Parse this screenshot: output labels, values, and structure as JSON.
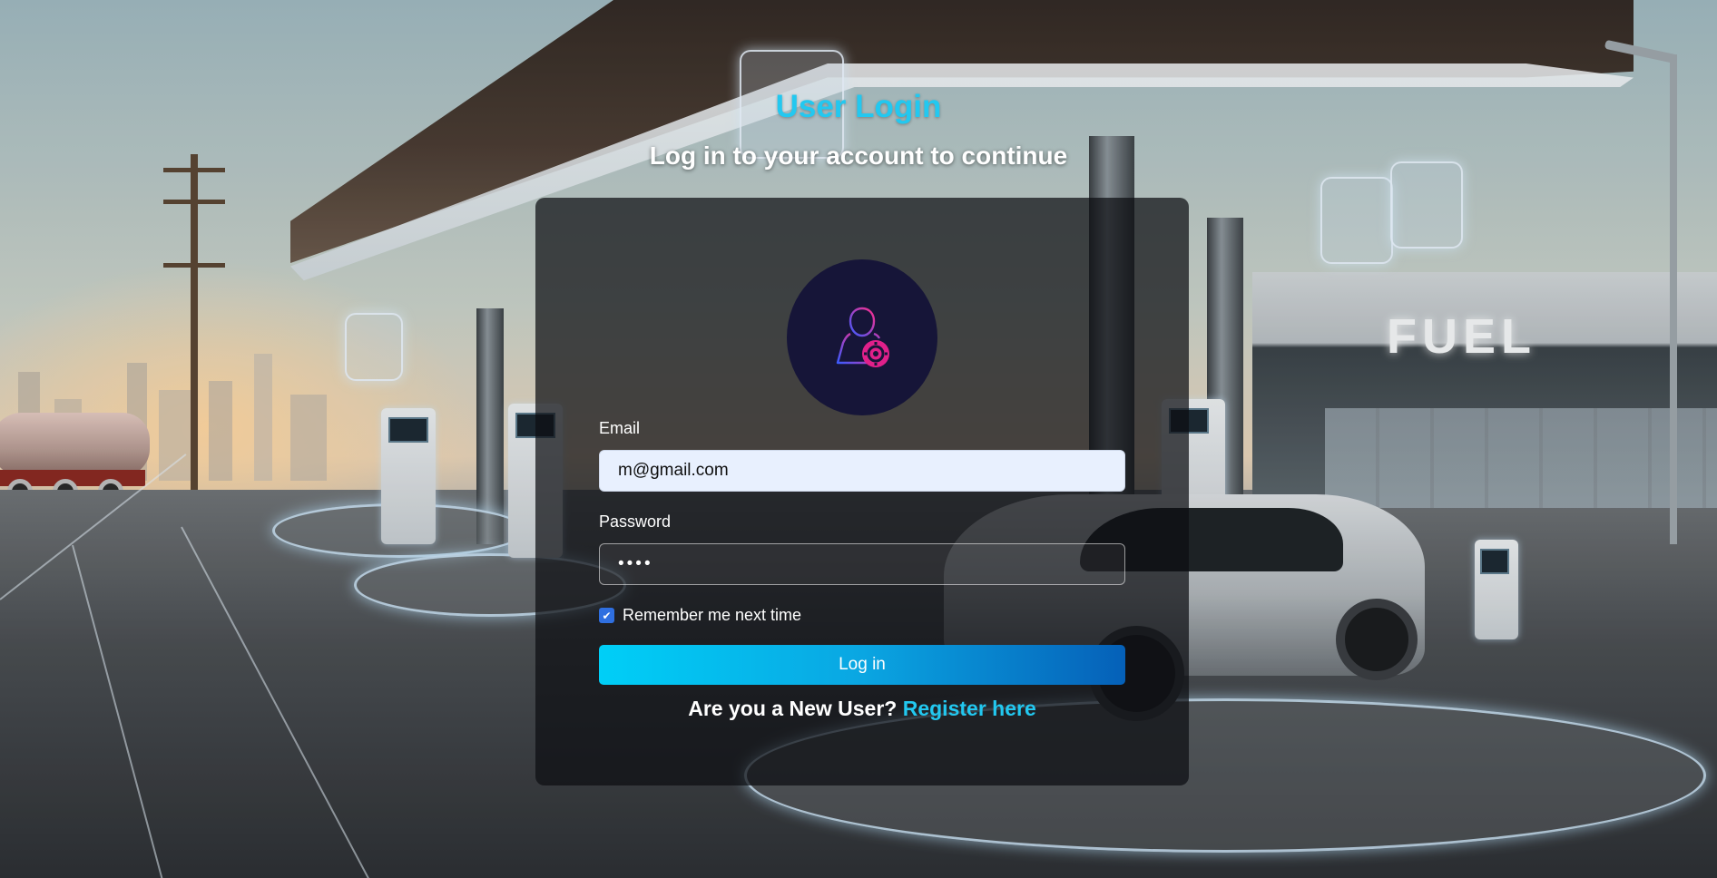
{
  "header": {
    "title": "User Login",
    "subtitle": "Log in to your account to continue"
  },
  "background": {
    "sign_text": "FUEL"
  },
  "form": {
    "avatar_icon": "user-gear-icon",
    "email": {
      "label": "Email",
      "value": "m@gmail.com"
    },
    "password": {
      "label": "Password",
      "value": "••••"
    },
    "remember": {
      "label": "Remember me next time",
      "checked": true
    },
    "submit_label": "Log in",
    "register_prompt": "Are you a New User?",
    "register_link": "Register here"
  },
  "colors": {
    "accent": "#22c8f0",
    "button_start": "#00cff7",
    "button_end": "#0560b8",
    "avatar_bg": "#161538",
    "checkbox": "#2f6fe0"
  }
}
